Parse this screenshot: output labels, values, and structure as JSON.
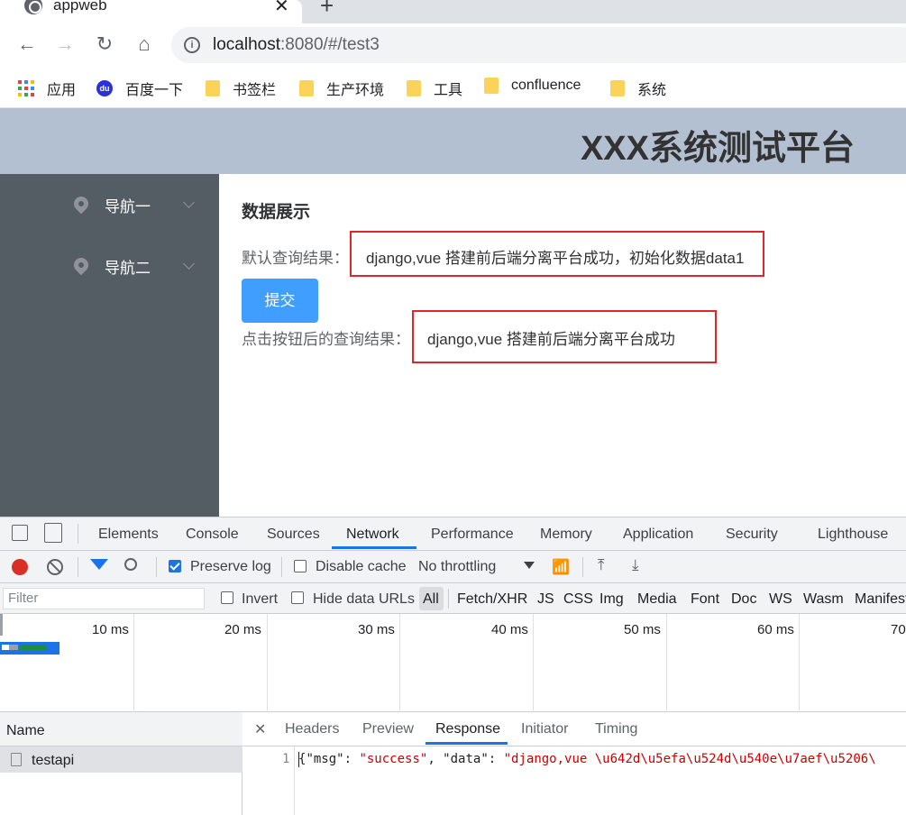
{
  "browser": {
    "tab_title": "appweb",
    "url_host": "localhost",
    "url_rest": ":8080/#/test3",
    "bookmarks": [
      "应用",
      "百度一下",
      "书签栏",
      "生产环境",
      "工具",
      "confluence",
      "系统"
    ],
    "baidu_icon_text": "du"
  },
  "app": {
    "title": "XXX系统测试平台",
    "nav": [
      "导航一",
      "导航二"
    ],
    "section_title": "数据展示",
    "default_label": "默认查询结果：",
    "default_result": "django,vue 搭建前后端分离平台成功，初始化数据data1",
    "submit_label": "提交",
    "click_label": "点击按钮后的查询结果：",
    "click_result": "django,vue 搭建前后端分离平台成功"
  },
  "devtools": {
    "tabs": [
      "Elements",
      "Console",
      "Sources",
      "Network",
      "Performance",
      "Memory",
      "Application",
      "Security",
      "Lighthouse"
    ],
    "active_tab": "Network",
    "preserve_log": "Preserve log",
    "disable_cache": "Disable cache",
    "throttling": "No throttling",
    "filter_placeholder": "Filter",
    "invert": "Invert",
    "hide_data_urls": "Hide data URLs",
    "types": [
      "All",
      "Fetch/XHR",
      "JS",
      "CSS",
      "Img",
      "Media",
      "Font",
      "Doc",
      "WS",
      "Wasm",
      "Manifest"
    ],
    "timeline_ticks": [
      "10 ms",
      "20 ms",
      "30 ms",
      "40 ms",
      "50 ms",
      "60 ms",
      "70"
    ],
    "name_header": "Name",
    "requests": [
      "testapi"
    ],
    "detail_tabs": [
      "Headers",
      "Preview",
      "Response",
      "Initiator",
      "Timing"
    ],
    "active_detail_tab": "Response",
    "response_line_no": "1",
    "response_parts": {
      "open": "{",
      "k1": "\"msg\"",
      "colon1": ": ",
      "v1": "\"success\"",
      "comma": ", ",
      "k2": "\"data\"",
      "colon2": ": ",
      "v2": "\"django,vue \\u642d\\u5efa\\u524d\\u540e\\u7aef\\u5206\\"
    }
  },
  "colors": {
    "header_bg": "#b3c0d1",
    "sidebar_bg": "#545c64",
    "primary": "#409eff",
    "highlight_border": "#e0262d",
    "devtools_accent": "#1a73e8"
  }
}
